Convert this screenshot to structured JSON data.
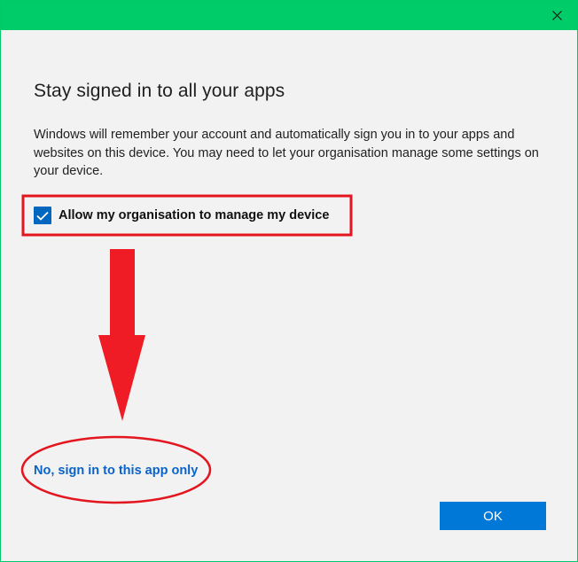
{
  "dialog": {
    "heading": "Stay signed in to all your apps",
    "description": "Windows will remember your account and automatically sign you in to your apps and websites on this device. You may need to let your organisation manage some settings on your device.",
    "checkbox": {
      "label": "Allow my organisation to manage my device",
      "checked": true
    },
    "secondary_link": "No, sign in to this app only",
    "ok_label": "OK"
  },
  "icons": {
    "close": "close-icon",
    "checkmark": "checkmark-icon"
  },
  "colors": {
    "titlebar": "#00cc6a",
    "accent": "#0078d7",
    "link": "#0a63c9",
    "annotation": "#e3161f"
  }
}
